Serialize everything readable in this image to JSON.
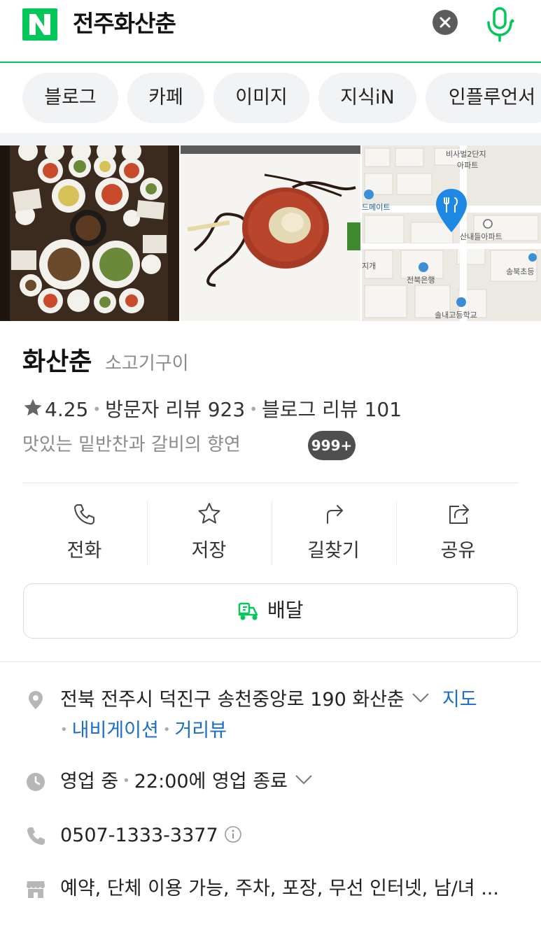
{
  "search": {
    "query": "전주화산춘"
  },
  "tabs": [
    "블로그",
    "카페",
    "이미지",
    "지식iN",
    "인플루언서"
  ],
  "photos": {
    "count_badge": "999+"
  },
  "map": {
    "labels": [
      "비사벌2단지",
      "아파트",
      "드메이트",
      "산내들아파트",
      "지개",
      "전북은행",
      "송북초등",
      "솔내고등학교"
    ]
  },
  "place": {
    "name": "화산춘",
    "category": "소고기구이",
    "rating": "4.25",
    "visitor_reviews": "방문자 리뷰 923",
    "blog_reviews": "블로그 리뷰 101",
    "description": "맛있는 밑반찬과 갈비의 향연"
  },
  "actions": {
    "call": "전화",
    "save": "저장",
    "directions": "길찾기",
    "share": "공유",
    "delivery": "배달"
  },
  "details": {
    "address": "전북 전주시 덕진구 송천중앙로 190 화산춘",
    "map_link": "지도",
    "navigation_link": "내비게이션",
    "street_view_link": "거리뷰",
    "hours_status": "영업 중",
    "hours_close": "22:00에 영업 종료",
    "phone": "0507-1333-3377",
    "amenities": "예약, 단체 이용 가능, 주차, 포장, 무선 인터넷, 남/녀 ..."
  },
  "colors": {
    "brand_green": "#03c75a",
    "link_blue": "#1a6ec9",
    "pin_blue": "#1e88e5"
  }
}
